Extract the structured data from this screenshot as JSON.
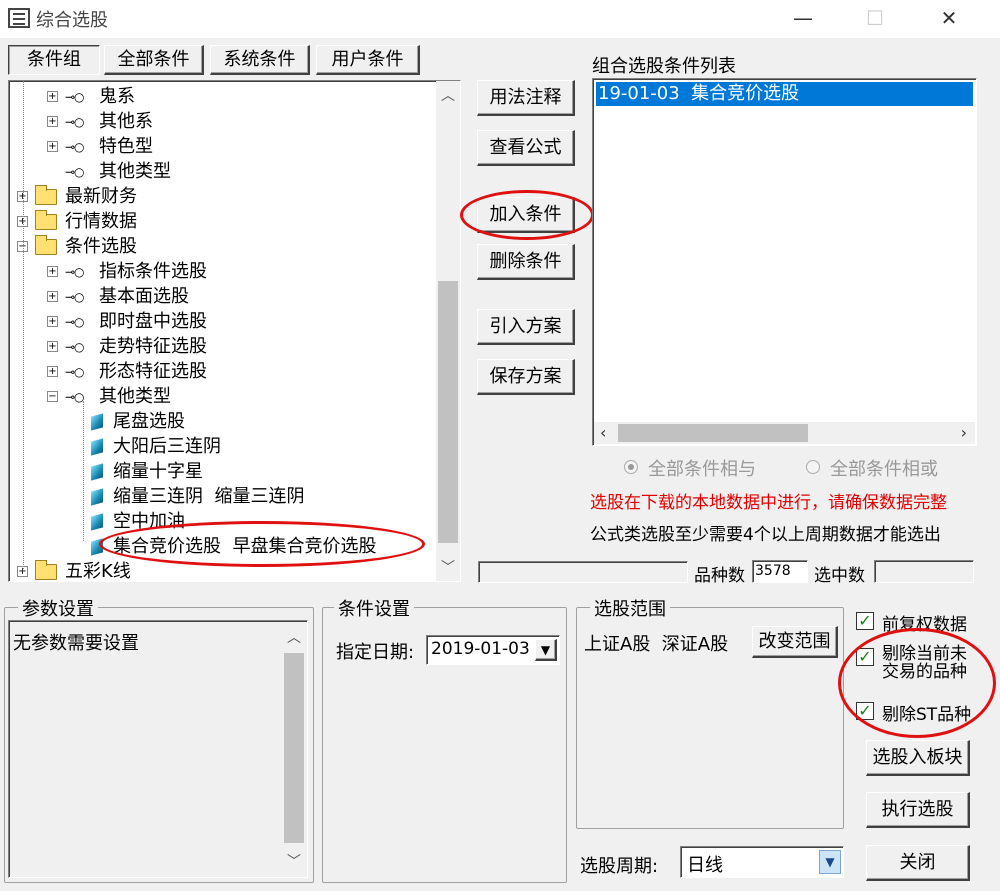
{
  "window": {
    "title": "综合选股",
    "minimize": "—",
    "maximize": "☐",
    "close": "✕"
  },
  "tabs": [
    "条件组",
    "全部条件",
    "系统条件",
    "用户条件"
  ],
  "tree": [
    {
      "label": "鬼系",
      "kind": "key",
      "toggle": "+"
    },
    {
      "label": "其他系",
      "kind": "key",
      "toggle": "+"
    },
    {
      "label": "特色型",
      "kind": "key",
      "toggle": "+"
    },
    {
      "label": "其他类型",
      "kind": "key",
      "toggle": ""
    },
    {
      "label": "最新财务",
      "kind": "folder",
      "toggle": "+"
    },
    {
      "label": "行情数据",
      "kind": "folder",
      "toggle": "+"
    },
    {
      "label": "条件选股",
      "kind": "folder",
      "toggle": "−"
    },
    {
      "label": "指标条件选股",
      "kind": "key",
      "toggle": "+"
    },
    {
      "label": "基本面选股",
      "kind": "key",
      "toggle": "+"
    },
    {
      "label": "即时盘中选股",
      "kind": "key",
      "toggle": "+"
    },
    {
      "label": "走势特征选股",
      "kind": "key",
      "toggle": "+"
    },
    {
      "label": "形态特征选股",
      "kind": "key",
      "toggle": "+"
    },
    {
      "label": "其他类型",
      "kind": "key",
      "toggle": "−"
    },
    {
      "label": "尾盘选股",
      "kind": "gem",
      "toggle": ""
    },
    {
      "label": "大阳后三连阴",
      "kind": "gem",
      "toggle": ""
    },
    {
      "label": "缩量十字星",
      "kind": "gem",
      "toggle": ""
    },
    {
      "label": "缩量三连阴  缩量三连阴",
      "kind": "gem",
      "toggle": ""
    },
    {
      "label": "空中加油",
      "kind": "gem",
      "toggle": ""
    },
    {
      "label": "集合竞价选股  早盘集合竞价选股",
      "kind": "gem",
      "toggle": ""
    },
    {
      "label": "五彩K线",
      "kind": "folder",
      "toggle": "+"
    }
  ],
  "actions": {
    "usage": "用法注释",
    "view_formula": "查看公式",
    "add": "加入条件",
    "delete": "删除条件",
    "import": "引入方案",
    "save": "保存方案"
  },
  "conditions": {
    "header": "组合选股条件列表",
    "items": [
      "19-01-03  集合竞价选股"
    ]
  },
  "logic": {
    "and_label": "全部条件相与",
    "or_label": "全部条件相或",
    "selected": "and"
  },
  "notes": {
    "warning": "选股在下载的本地数据中进行，请确保数据完整",
    "info": "公式类选股至少需要4个以上周期数据才能选出",
    "warning_color": "#e00000"
  },
  "stats": {
    "count_label": "品种数",
    "count_value": "3578",
    "selected_label": "选中数",
    "selected_value": ""
  },
  "params": {
    "title": "参数设置",
    "text": "无参数需要设置"
  },
  "cond_settings": {
    "title": "条件设置",
    "date_label": "指定日期:",
    "date_value": "2019-01-03"
  },
  "range": {
    "title": "选股范围",
    "markets": "上证A股  深证A股",
    "change_button": "改变范围"
  },
  "options": {
    "fq": "前复权数据",
    "exclude_untraded_1": "剔除当前未",
    "exclude_untraded_2": "交易的品种",
    "exclude_st": "剔除ST品种"
  },
  "bottom": {
    "to_block": "选股入板块",
    "execute": "执行选股",
    "close": "关闭",
    "period_label": "选股周期:",
    "period_value": "日线"
  },
  "colors": {
    "selection": "#0078d7",
    "annotation": "#e01010"
  }
}
